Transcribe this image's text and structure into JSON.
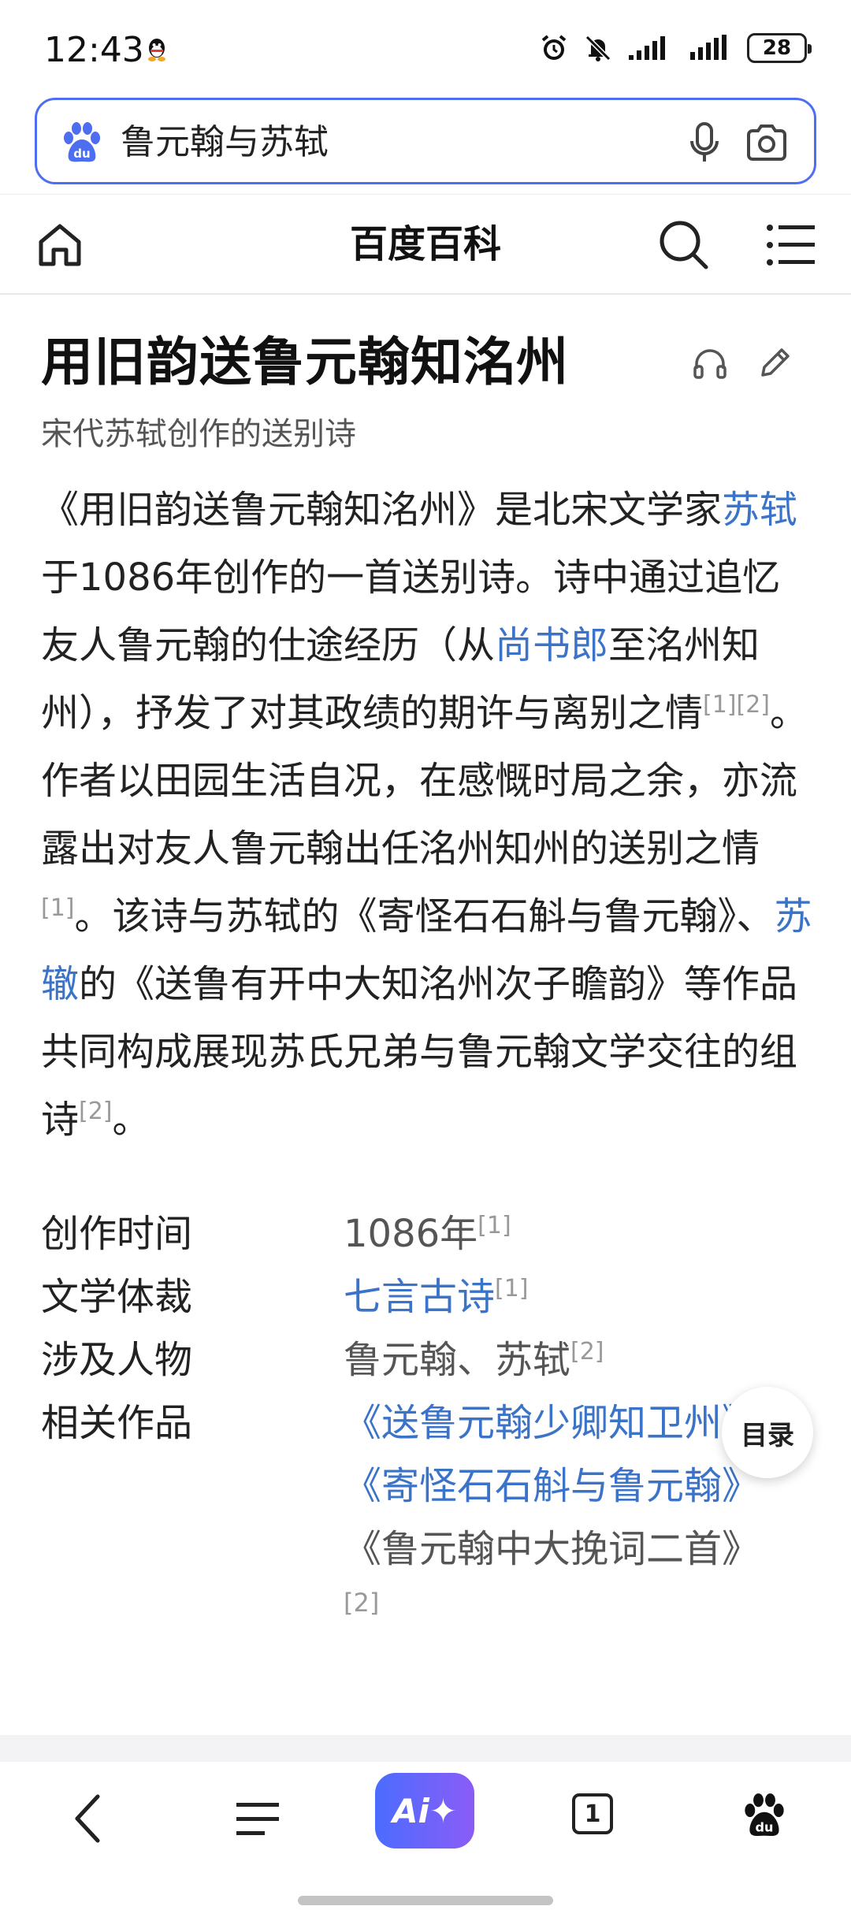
{
  "status_bar": {
    "time": "12:43",
    "battery": "28"
  },
  "search": {
    "query": "鲁元翰与苏轼"
  },
  "header": {
    "title": "百度百科"
  },
  "entry": {
    "title": "用旧韵送鲁元翰知洺州",
    "subtitle": "宋代苏轼创作的送别诗",
    "summary": {
      "p1": "《用旧韵送鲁元翰知洺州》是北宋文学家",
      "link_sushi": "苏轼",
      "p2": "于1086年创作的一首送别诗。诗中通过追忆友人鲁元翰的仕途经历（从",
      "link_shangshulang": "尚书郎",
      "p3": "至洺州知州），抒发了对其政绩的期许与离别之情",
      "ref_a": "[1][2]",
      "p4": "。作者以田园生活自况，在感慨时局之余，亦流露出对友人鲁元翰出任洺州知州的送别之情",
      "ref_b": "[1]",
      "p5": "。该诗与苏轼的《寄怪石石斛与鲁元翰》、",
      "link_suzhe": "苏辙",
      "p6": "的《送鲁有开中大知洺州次子瞻韵》等作品共同构成展现苏氏兄弟与鲁元翰文学交往的组诗",
      "ref_c": "[2]",
      "p7": "。"
    },
    "info": {
      "time_key": "创作时间",
      "time_val": "1086年",
      "time_ref": "[1]",
      "genre_key": "文学体裁",
      "genre_val": "七言古诗",
      "genre_ref": "[1]",
      "people_key": "涉及人物",
      "people_val": "鲁元翰、苏轼",
      "people_ref": "[2]",
      "works_key": "相关作品",
      "works": [
        "《送鲁元翰少卿知卫州》",
        "《寄怪石石斛与鲁元翰》",
        "《鲁元翰中大挽词二首》"
      ],
      "works_ref": "[2]"
    }
  },
  "toc_button": "目录",
  "bottom_nav": {
    "ai_label": "Ai✦",
    "tab_count": "1"
  }
}
